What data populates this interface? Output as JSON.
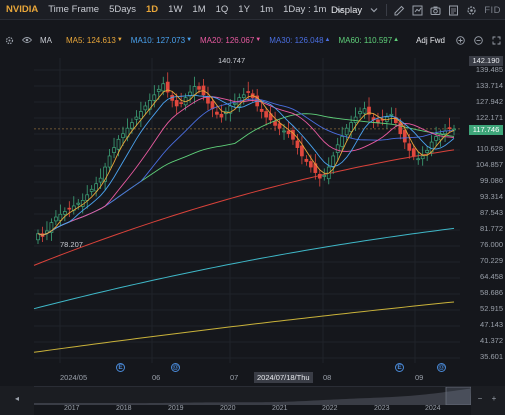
{
  "toolbar": {
    "symbol": "NVIDIA",
    "timeframe_label": "Time Frame",
    "periods": [
      "5Days",
      "1D",
      "1W",
      "1M",
      "1Q",
      "1Y",
      "1m"
    ],
    "active_period": "1D",
    "interval": "1Day : 1m",
    "display_label": "Display",
    "fid_label": "FID"
  },
  "ma_legend": {
    "label": "MA",
    "adj_label": "Adj Fwd",
    "items": [
      {
        "name": "MA5",
        "value": "124.613",
        "color": "#e8a63a",
        "trend": "down"
      },
      {
        "name": "MA10",
        "value": "127.073",
        "color": "#4aa3f0",
        "trend": "down"
      },
      {
        "name": "MA20",
        "value": "126.067",
        "color": "#e85aa0",
        "trend": "down"
      },
      {
        "name": "MA30",
        "value": "126.048",
        "color": "#4a6ee0",
        "trend": "up"
      },
      {
        "name": "MA60",
        "value": "110.597",
        "color": "#5fd07a",
        "trend": "up"
      }
    ]
  },
  "price_axis": {
    "top_box": "142.190",
    "current_box": "117.746",
    "labels": [
      "139.485",
      "133.714",
      "127.942",
      "122.171",
      "116.628",
      "110.628",
      "104.857",
      "99.086",
      "93.314",
      "87.543",
      "81.772",
      "76.000",
      "70.229",
      "64.458",
      "58.686",
      "52.915",
      "47.143",
      "41.372",
      "35.601"
    ]
  },
  "annotations": {
    "high": "140.747",
    "low": "78.207"
  },
  "date_axis": {
    "labels": [
      "2024/05",
      "06",
      "07",
      "08",
      "09"
    ],
    "selected": "2024/07/18/Thu"
  },
  "events": [
    "E",
    "@",
    "E",
    "@"
  ],
  "navigator_years": [
    "2017",
    "2018",
    "2019",
    "2020",
    "2021",
    "2022",
    "2023",
    "2024"
  ],
  "colors": {
    "up": "#3ea67a",
    "down": "#e0483e",
    "ma5": "#e8a63a",
    "ma10": "#4aa3f0",
    "ma20": "#e85aa0",
    "ma30": "#4a6ee0",
    "ma60": "#5fd07a",
    "ma120": "#d9423a",
    "ma250": "#3fb8c8",
    "ma_long": "#c9b23a"
  }
}
